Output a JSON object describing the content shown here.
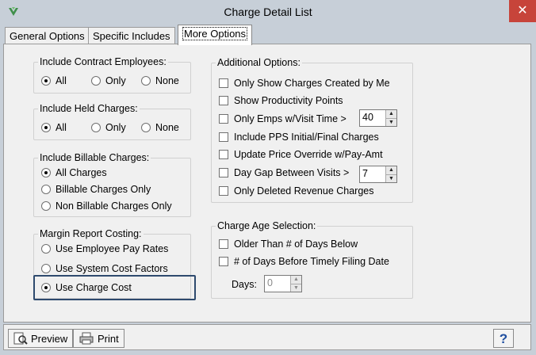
{
  "window": {
    "title": "Charge Detail List",
    "close_label": "✕"
  },
  "tabs": [
    {
      "label": "General Options"
    },
    {
      "label": "Specific Includes"
    },
    {
      "label": "More Options"
    }
  ],
  "groups": {
    "contract": {
      "title": "Include Contract Employees:",
      "options": [
        "All",
        "Only",
        "None"
      ],
      "selected": "All"
    },
    "held": {
      "title": "Include Held Charges:",
      "options": [
        "All",
        "Only",
        "None"
      ],
      "selected": "All"
    },
    "billable": {
      "title": "Include Billable Charges:",
      "options": [
        "All Charges",
        "Billable Charges Only",
        "Non Billable Charges Only"
      ],
      "selected": "All Charges"
    },
    "margin": {
      "title": "Margin Report Costing:",
      "options": [
        "Use Employee Pay Rates",
        "Use System Cost Factors",
        "Use Charge Cost"
      ],
      "selected": "Use Charge Cost"
    },
    "additional": {
      "title": "Additional Options:",
      "items": [
        "Only Show Charges Created by Me",
        "Show Productivity Points",
        "Only Emps w/Visit Time >",
        "Include PPS Initial/Final Charges",
        "Update Price Override w/Pay-Amt",
        "Day Gap Between Visits >",
        "Only Deleted Revenue Charges"
      ],
      "visit_time_value": "40",
      "day_gap_value": "7"
    },
    "age": {
      "title": "Charge Age Selection:",
      "items": [
        "Older Than # of Days Below",
        "# of Days Before Timely Filing Date"
      ],
      "days_label": "Days:",
      "days_value": "0"
    }
  },
  "footer": {
    "preview_label": "Preview",
    "print_label": "Print",
    "help_label": "?"
  }
}
